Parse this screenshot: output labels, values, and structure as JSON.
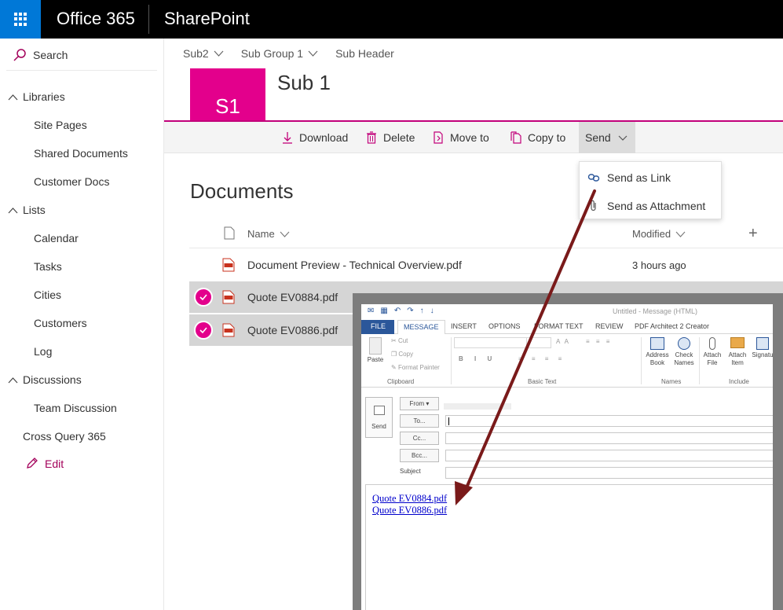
{
  "topbar": {
    "brand": "Office 365",
    "app": "SharePoint"
  },
  "search": {
    "label": "Search"
  },
  "nav": {
    "libraries": "Libraries",
    "library_items": [
      "Site Pages",
      "Shared Documents",
      "Customer Docs"
    ],
    "lists": "Lists",
    "list_items": [
      "Calendar",
      "Tasks",
      "Cities",
      "Customers",
      "Log"
    ],
    "discussions": "Discussions",
    "discussion_items": [
      "Team Discussion"
    ],
    "cross": "Cross Query 365",
    "edit": "Edit"
  },
  "breadcrumbs": [
    "Sub2",
    "Sub Group 1",
    "Sub Header"
  ],
  "site": {
    "logo_text": "S1",
    "title": "Sub 1"
  },
  "commands": {
    "download": "Download",
    "delete": "Delete",
    "move": "Move to",
    "copy": "Copy to",
    "send": "Send"
  },
  "send_menu": {
    "link": "Send as Link",
    "attachment": "Send as Attachment"
  },
  "library": {
    "title": "Documents",
    "col_name": "Name",
    "col_modified": "Modified",
    "col_add": "+",
    "rows": [
      {
        "name": "Document Preview - Technical Overview.pdf",
        "modified": "3 hours ago",
        "selected": false
      },
      {
        "name": "Quote EV0884.pdf",
        "modified": "",
        "selected": true
      },
      {
        "name": "Quote EV0886.pdf",
        "modified": "",
        "selected": true
      }
    ]
  },
  "outlook": {
    "title": "Untitled - Message (HTML)",
    "tabs": [
      "FILE",
      "MESSAGE",
      "INSERT",
      "OPTIONS",
      "FORMAT TEXT",
      "REVIEW",
      "PDF Architect 2 Creator"
    ],
    "ribbon": {
      "paste": "Paste",
      "cut": "Cut",
      "copy": "Copy",
      "format_painter": "Format Painter",
      "clipboard": "Clipboard",
      "basic_text": "Basic Text",
      "address_book": "Address Book",
      "check_names": "Check Names",
      "names": "Names",
      "attach_file": "Attach File",
      "attach_item": "Attach Item",
      "signature": "Signatu",
      "include": "Include"
    },
    "send": "Send",
    "from": "From",
    "to": "To...",
    "cc": "Cc...",
    "bcc": "Bcc...",
    "subject": "Subject",
    "links": [
      "Quote EV0884.pdf",
      "Quote EV0886.pdf"
    ]
  },
  "colors": {
    "accent": "#e3008c",
    "waffle": "#0078d7",
    "arrow": "#7a1a1a"
  }
}
